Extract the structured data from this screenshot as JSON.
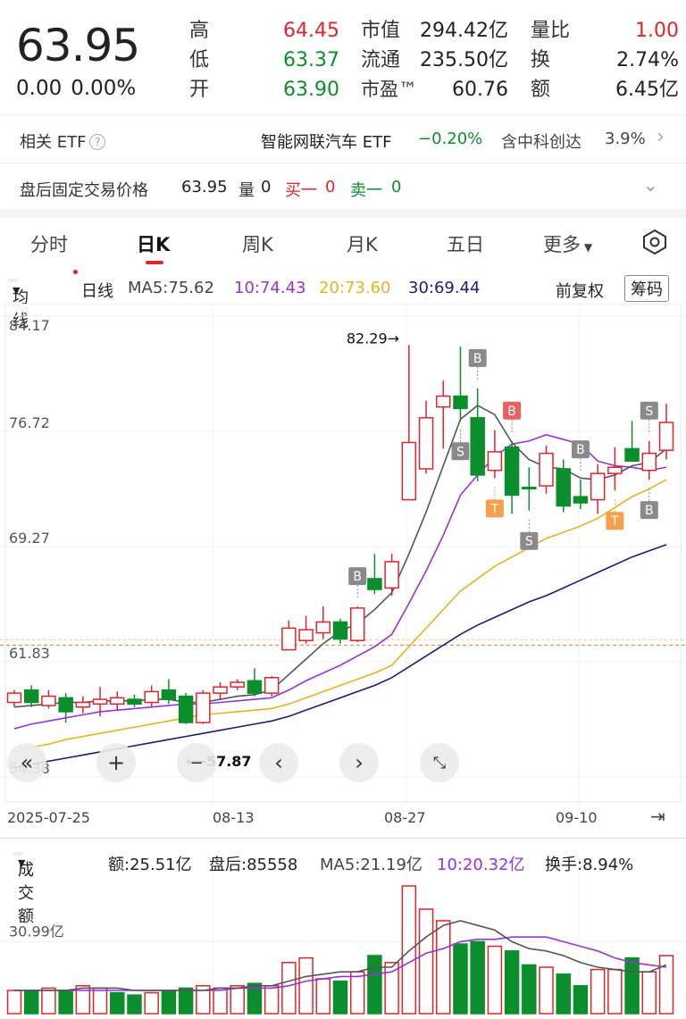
{
  "quote": {
    "price": "63.95",
    "change": "0.00",
    "change_pct": "0.00%",
    "labels": {
      "high": "高",
      "low": "低",
      "open": "开",
      "mktcap": "市值",
      "float": "流通",
      "pe": "市盈™",
      "vol_ratio": "量比",
      "turnover": "换",
      "amount": "额"
    },
    "values": {
      "high": "64.45",
      "low": "63.37",
      "open": "63.90",
      "mktcap": "294.42亿",
      "float": "235.50亿",
      "pe": "60.76",
      "vol_ratio": "1.00",
      "turnover": "2.74%",
      "amount": "6.45亿"
    }
  },
  "etf_row": {
    "label": "相关 ETF",
    "help_icon": "question-circle-icon",
    "etf_name": "智能网联汽车 ETF",
    "etf_change": "−0.20%",
    "holding": "含中科创达",
    "holding_pct": "3.9%"
  },
  "after_hours": {
    "label": "盘后固定交易价格",
    "price": "63.95",
    "vol_label": "量",
    "vol": "0",
    "bid_label": "买一",
    "bid": "0",
    "ask_label": "卖一",
    "ask": "0"
  },
  "tabs": [
    "分时",
    "日K",
    "周K",
    "月K",
    "五日",
    "更多"
  ],
  "indicator": {
    "select": "均线",
    "period": "日线",
    "ma5": "MA5:75.62",
    "ma10": "10:74.43",
    "ma20": "20:73.60",
    "ma30": "30:69.44",
    "adjust": "前复权",
    "chip": "筹码"
  },
  "colors": {
    "up": "#e0242b",
    "down": "#0a8f2c",
    "ma5": "#555555",
    "ma10": "#9b30d9",
    "ma20": "#e8b220",
    "ma30": "#1c1c7a"
  },
  "price_axis": [
    "84.17",
    "76.72",
    "69.27",
    "61.83",
    "54.38"
  ],
  "price_labels": {
    "high": "82.29→",
    "low": "⟵57.87"
  },
  "x_labels": [
    "2025-07-25",
    "08-13",
    "08-27",
    "09-10"
  ],
  "volume": {
    "select": "成交额",
    "amount": "额:25.51亿",
    "after": "盘后:85558",
    "ma5": "MA5:21.19亿",
    "ma10": "10:20.32亿",
    "turnover": "换手:8.94%",
    "axis_label": "30.99亿"
  },
  "chart_data": {
    "type": "candlestick",
    "y_range": [
      54.38,
      84.17
    ],
    "candles": [
      {
        "o": 59.2,
        "c": 59.8,
        "h": 60.0,
        "l": 58.9,
        "up": true
      },
      {
        "o": 60.0,
        "c": 59.2,
        "h": 60.3,
        "l": 58.9,
        "up": false
      },
      {
        "o": 59.0,
        "c": 59.6,
        "h": 60.0,
        "l": 58.8,
        "up": true
      },
      {
        "o": 59.5,
        "c": 58.6,
        "h": 59.8,
        "l": 57.9,
        "up": false
      },
      {
        "o": 58.9,
        "c": 59.2,
        "h": 59.6,
        "l": 58.5,
        "up": true
      },
      {
        "o": 59.1,
        "c": 59.4,
        "h": 60.2,
        "l": 58.3,
        "up": true
      },
      {
        "o": 59.1,
        "c": 59.5,
        "h": 59.9,
        "l": 58.7,
        "up": true
      },
      {
        "o": 59.4,
        "c": 59.1,
        "h": 59.7,
        "l": 58.9,
        "up": false
      },
      {
        "o": 59.2,
        "c": 59.9,
        "h": 60.3,
        "l": 58.9,
        "up": true
      },
      {
        "o": 60.0,
        "c": 59.4,
        "h": 60.7,
        "l": 59.1,
        "up": false
      },
      {
        "o": 59.6,
        "c": 57.9,
        "h": 59.8,
        "l": 57.8,
        "up": false
      },
      {
        "o": 57.9,
        "c": 59.8,
        "h": 60.0,
        "l": 57.8,
        "up": true
      },
      {
        "o": 59.8,
        "c": 60.2,
        "h": 60.5,
        "l": 59.4,
        "up": true
      },
      {
        "o": 60.2,
        "c": 60.5,
        "h": 60.7,
        "l": 60.0,
        "up": true
      },
      {
        "o": 60.6,
        "c": 59.8,
        "h": 61.4,
        "l": 59.6,
        "up": false
      },
      {
        "o": 59.8,
        "c": 60.8,
        "h": 60.9,
        "l": 59.6,
        "up": true
      },
      {
        "o": 62.6,
        "c": 64.0,
        "h": 64.5,
        "l": 62.6,
        "up": true
      },
      {
        "o": 63.2,
        "c": 63.9,
        "h": 64.8,
        "l": 63.0,
        "up": true
      },
      {
        "o": 63.7,
        "c": 64.4,
        "h": 65.4,
        "l": 63.3,
        "up": true
      },
      {
        "o": 64.4,
        "c": 63.3,
        "h": 64.6,
        "l": 63.0,
        "up": false
      },
      {
        "o": 63.2,
        "c": 65.3,
        "h": 65.4,
        "l": 63.1,
        "up": true
      },
      {
        "o": 67.2,
        "c": 66.5,
        "h": 68.8,
        "l": 66.2,
        "up": false
      },
      {
        "o": 66.6,
        "c": 68.3,
        "h": 68.8,
        "l": 66.1,
        "up": true
      },
      {
        "o": 72.3,
        "c": 76.0,
        "h": 82.3,
        "l": 72.3,
        "up": true
      },
      {
        "o": 74.3,
        "c": 77.6,
        "h": 78.7,
        "l": 74.0,
        "up": true
      },
      {
        "o": 78.3,
        "c": 79.0,
        "h": 80.0,
        "l": 75.6,
        "up": true
      },
      {
        "o": 79.0,
        "c": 78.2,
        "h": 82.2,
        "l": 77.4,
        "up": false
      },
      {
        "o": 77.6,
        "c": 73.9,
        "h": 79.5,
        "l": 73.5,
        "up": false
      },
      {
        "o": 74.2,
        "c": 75.4,
        "h": 76.8,
        "l": 73.7,
        "up": true
      },
      {
        "o": 75.7,
        "c": 72.6,
        "h": 76.1,
        "l": 71.4,
        "up": false
      },
      {
        "o": 73.1,
        "c": 73.1,
        "h": 74.4,
        "l": 71.6,
        "up": false
      },
      {
        "o": 73.2,
        "c": 75.3,
        "h": 75.8,
        "l": 72.7,
        "up": true
      },
      {
        "o": 74.3,
        "c": 71.9,
        "h": 74.9,
        "l": 71.5,
        "up": false
      },
      {
        "o": 72.5,
        "c": 72.1,
        "h": 73.6,
        "l": 71.7,
        "up": false
      },
      {
        "o": 72.3,
        "c": 74.0,
        "h": 74.6,
        "l": 71.4,
        "up": true
      },
      {
        "o": 74.0,
        "c": 74.4,
        "h": 75.7,
        "l": 72.9,
        "up": true
      },
      {
        "o": 75.6,
        "c": 74.8,
        "h": 77.4,
        "l": 74.8,
        "up": false
      },
      {
        "o": 74.2,
        "c": 75.3,
        "h": 76.1,
        "l": 73.6,
        "up": true
      },
      {
        "o": 75.5,
        "c": 77.3,
        "h": 78.5,
        "l": 74.9,
        "up": true
      }
    ],
    "volumes": [
      {
        "v": 10,
        "up": true
      },
      {
        "v": 10,
        "up": false
      },
      {
        "v": 11,
        "up": true
      },
      {
        "v": 10,
        "up": false
      },
      {
        "v": 12,
        "up": true
      },
      {
        "v": 11,
        "up": true
      },
      {
        "v": 9,
        "up": false
      },
      {
        "v": 8,
        "up": false
      },
      {
        "v": 9,
        "up": true
      },
      {
        "v": 10,
        "up": false
      },
      {
        "v": 11,
        "up": false
      },
      {
        "v": 12,
        "up": true
      },
      {
        "v": 11,
        "up": true
      },
      {
        "v": 12,
        "up": true
      },
      {
        "v": 13,
        "up": false
      },
      {
        "v": 12,
        "up": true
      },
      {
        "v": 22,
        "up": true
      },
      {
        "v": 24,
        "up": true
      },
      {
        "v": 15,
        "up": true
      },
      {
        "v": 14,
        "up": false
      },
      {
        "v": 18,
        "up": true
      },
      {
        "v": 25,
        "up": false
      },
      {
        "v": 22,
        "up": true
      },
      {
        "v": 55,
        "up": true
      },
      {
        "v": 45,
        "up": true
      },
      {
        "v": 40,
        "up": true
      },
      {
        "v": 30,
        "up": false
      },
      {
        "v": 31,
        "up": false
      },
      {
        "v": 29,
        "up": true
      },
      {
        "v": 27,
        "up": false
      },
      {
        "v": 21,
        "up": false
      },
      {
        "v": 20,
        "up": true
      },
      {
        "v": 17,
        "up": false
      },
      {
        "v": 12,
        "up": false
      },
      {
        "v": 19,
        "up": true
      },
      {
        "v": 19,
        "up": true
      },
      {
        "v": 24,
        "up": false
      },
      {
        "v": 18,
        "up": true
      },
      {
        "v": 25,
        "up": true
      }
    ],
    "ma": {
      "ma5": [
        58.9,
        59.0,
        59.1,
        59.2,
        59.2,
        59.3,
        59.3,
        59.3,
        59.4,
        59.4,
        59.2,
        59.2,
        59.4,
        59.6,
        59.7,
        60.0,
        61.0,
        62.0,
        63.0,
        63.8,
        64.3,
        65.2,
        66.3,
        68.8,
        71.5,
        74.5,
        77.5,
        78.4,
        77.8,
        76.0,
        74.9,
        74.4,
        74.3,
        73.7,
        73.6,
        73.9,
        74.5,
        74.7,
        75.6
      ],
      "ma10": [
        57.5,
        57.8,
        58.0,
        58.2,
        58.4,
        58.6,
        58.7,
        58.8,
        58.9,
        59.0,
        59.1,
        59.1,
        59.2,
        59.3,
        59.4,
        59.5,
        60.0,
        60.6,
        61.1,
        61.6,
        62.2,
        62.8,
        63.6,
        65.6,
        67.7,
        70.0,
        72.6,
        73.9,
        75.1,
        75.9,
        76.1,
        76.5,
        76.2,
        75.9,
        74.8,
        74.5,
        74.4,
        74.2,
        74.4
      ],
      "ma20": [
        56.0,
        56.3,
        56.5,
        56.8,
        57.0,
        57.2,
        57.4,
        57.6,
        57.8,
        58.0,
        58.2,
        58.4,
        58.5,
        58.6,
        58.7,
        58.8,
        59.1,
        59.5,
        59.9,
        60.3,
        60.7,
        61.1,
        61.6,
        62.8,
        64.0,
        65.2,
        66.4,
        67.2,
        68.0,
        68.6,
        69.2,
        69.8,
        70.2,
        70.6,
        71.1,
        71.8,
        72.5,
        73.0,
        73.6
      ],
      "ma30": [
        55.0,
        55.2,
        55.4,
        55.6,
        55.8,
        56.0,
        56.2,
        56.4,
        56.6,
        56.8,
        57.0,
        57.2,
        57.4,
        57.6,
        57.8,
        58.0,
        58.3,
        58.7,
        59.1,
        59.5,
        59.9,
        60.3,
        60.8,
        61.5,
        62.2,
        62.9,
        63.6,
        64.2,
        64.7,
        65.2,
        65.7,
        66.1,
        66.6,
        67.1,
        67.6,
        68.1,
        68.6,
        69.0,
        69.4
      ],
      "vol_ma5": [
        10,
        10,
        10,
        10,
        11,
        11,
        11,
        10,
        10,
        10,
        10,
        10,
        11,
        11,
        12,
        12,
        14,
        16,
        17,
        18,
        18,
        20,
        20,
        27,
        33,
        38,
        40,
        38,
        36,
        31,
        28,
        27,
        25,
        22,
        20,
        19,
        18,
        18,
        21
      ],
      "vol_ma10": [
        10,
        10,
        10,
        10,
        10,
        10,
        10,
        10,
        10,
        10,
        10,
        10,
        10,
        11,
        11,
        11,
        12,
        14,
        15,
        16,
        16,
        17,
        18,
        22,
        26,
        28,
        31,
        32,
        32,
        33,
        33,
        33,
        31,
        29,
        27,
        24,
        22,
        21,
        20
      ]
    },
    "markers": [
      {
        "i": 20,
        "label": "B",
        "kind": "gray"
      },
      {
        "i": 27,
        "label": "B",
        "kind": "gray"
      },
      {
        "i": 29,
        "label": "B",
        "kind": "red"
      },
      {
        "i": 26,
        "label": "S",
        "kind": "gray"
      },
      {
        "i": 30,
        "label": "S",
        "kind": "gray"
      },
      {
        "i": 33,
        "label": "B",
        "kind": "gray"
      },
      {
        "i": 37,
        "label": "S",
        "kind": "gray"
      },
      {
        "i": 28,
        "label": "T",
        "kind": "orange"
      },
      {
        "i": 35,
        "label": "T",
        "kind": "orange"
      },
      {
        "i": 37,
        "label": "B",
        "kind": "gray"
      }
    ],
    "ref_line": 62.9
  }
}
